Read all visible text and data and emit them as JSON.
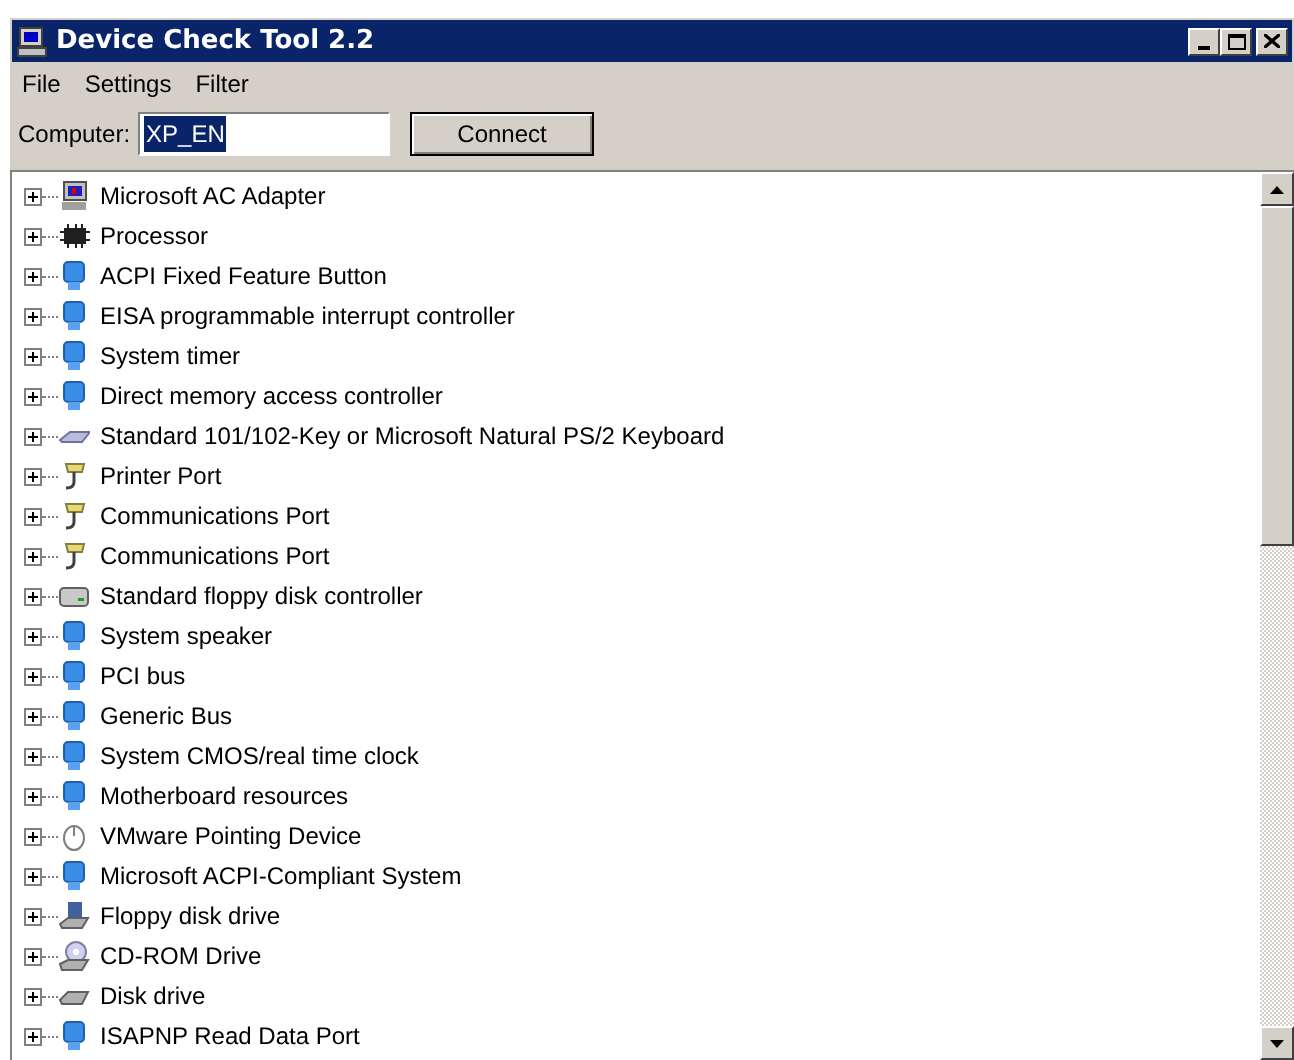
{
  "window": {
    "title": "Device Check Tool 2.2"
  },
  "menu": [
    "File",
    "Settings",
    "Filter"
  ],
  "toolbar": {
    "label": "Computer:",
    "computer": "XP_EN",
    "button": "Connect"
  },
  "tree": [
    {
      "label": "Microsoft AC Adapter",
      "kind": "adapter",
      "expanded": false
    },
    {
      "label": "Processor",
      "kind": "chip",
      "expanded": false
    },
    {
      "label": "ACPI Fixed Feature Button",
      "kind": "device",
      "expanded": false
    },
    {
      "label": "EISA programmable interrupt controller",
      "kind": "device",
      "expanded": false
    },
    {
      "label": "System timer",
      "kind": "device",
      "expanded": false
    },
    {
      "label": "Direct memory access controller",
      "kind": "device",
      "expanded": false
    },
    {
      "label": "Standard 101/102-Key or Microsoft Natural PS/2 Keyboard",
      "kind": "keyboard",
      "expanded": false
    },
    {
      "label": "Printer Port",
      "kind": "port",
      "expanded": false
    },
    {
      "label": "Communications Port",
      "kind": "port",
      "expanded": false
    },
    {
      "label": "Communications Port",
      "kind": "port",
      "expanded": false
    },
    {
      "label": "Standard floppy disk controller",
      "kind": "controller",
      "expanded": false
    },
    {
      "label": "System speaker",
      "kind": "device",
      "expanded": false
    },
    {
      "label": "PCI bus",
      "kind": "device",
      "expanded": false
    },
    {
      "label": "Generic Bus",
      "kind": "device",
      "expanded": false
    },
    {
      "label": "System CMOS/real time clock",
      "kind": "device",
      "expanded": false
    },
    {
      "label": "Motherboard resources",
      "kind": "device",
      "expanded": false
    },
    {
      "label": "VMware Pointing Device",
      "kind": "mouse",
      "expanded": false
    },
    {
      "label": "Microsoft ACPI-Compliant System",
      "kind": "device",
      "expanded": false
    },
    {
      "label": "Floppy disk drive",
      "kind": "floppy",
      "expanded": false
    },
    {
      "label": "CD-ROM Drive",
      "kind": "cdrom",
      "expanded": false
    },
    {
      "label": "Disk drive",
      "kind": "disk",
      "expanded": false
    },
    {
      "label": "ISAPNP Read Data Port",
      "kind": "device",
      "expanded": false
    }
  ]
}
